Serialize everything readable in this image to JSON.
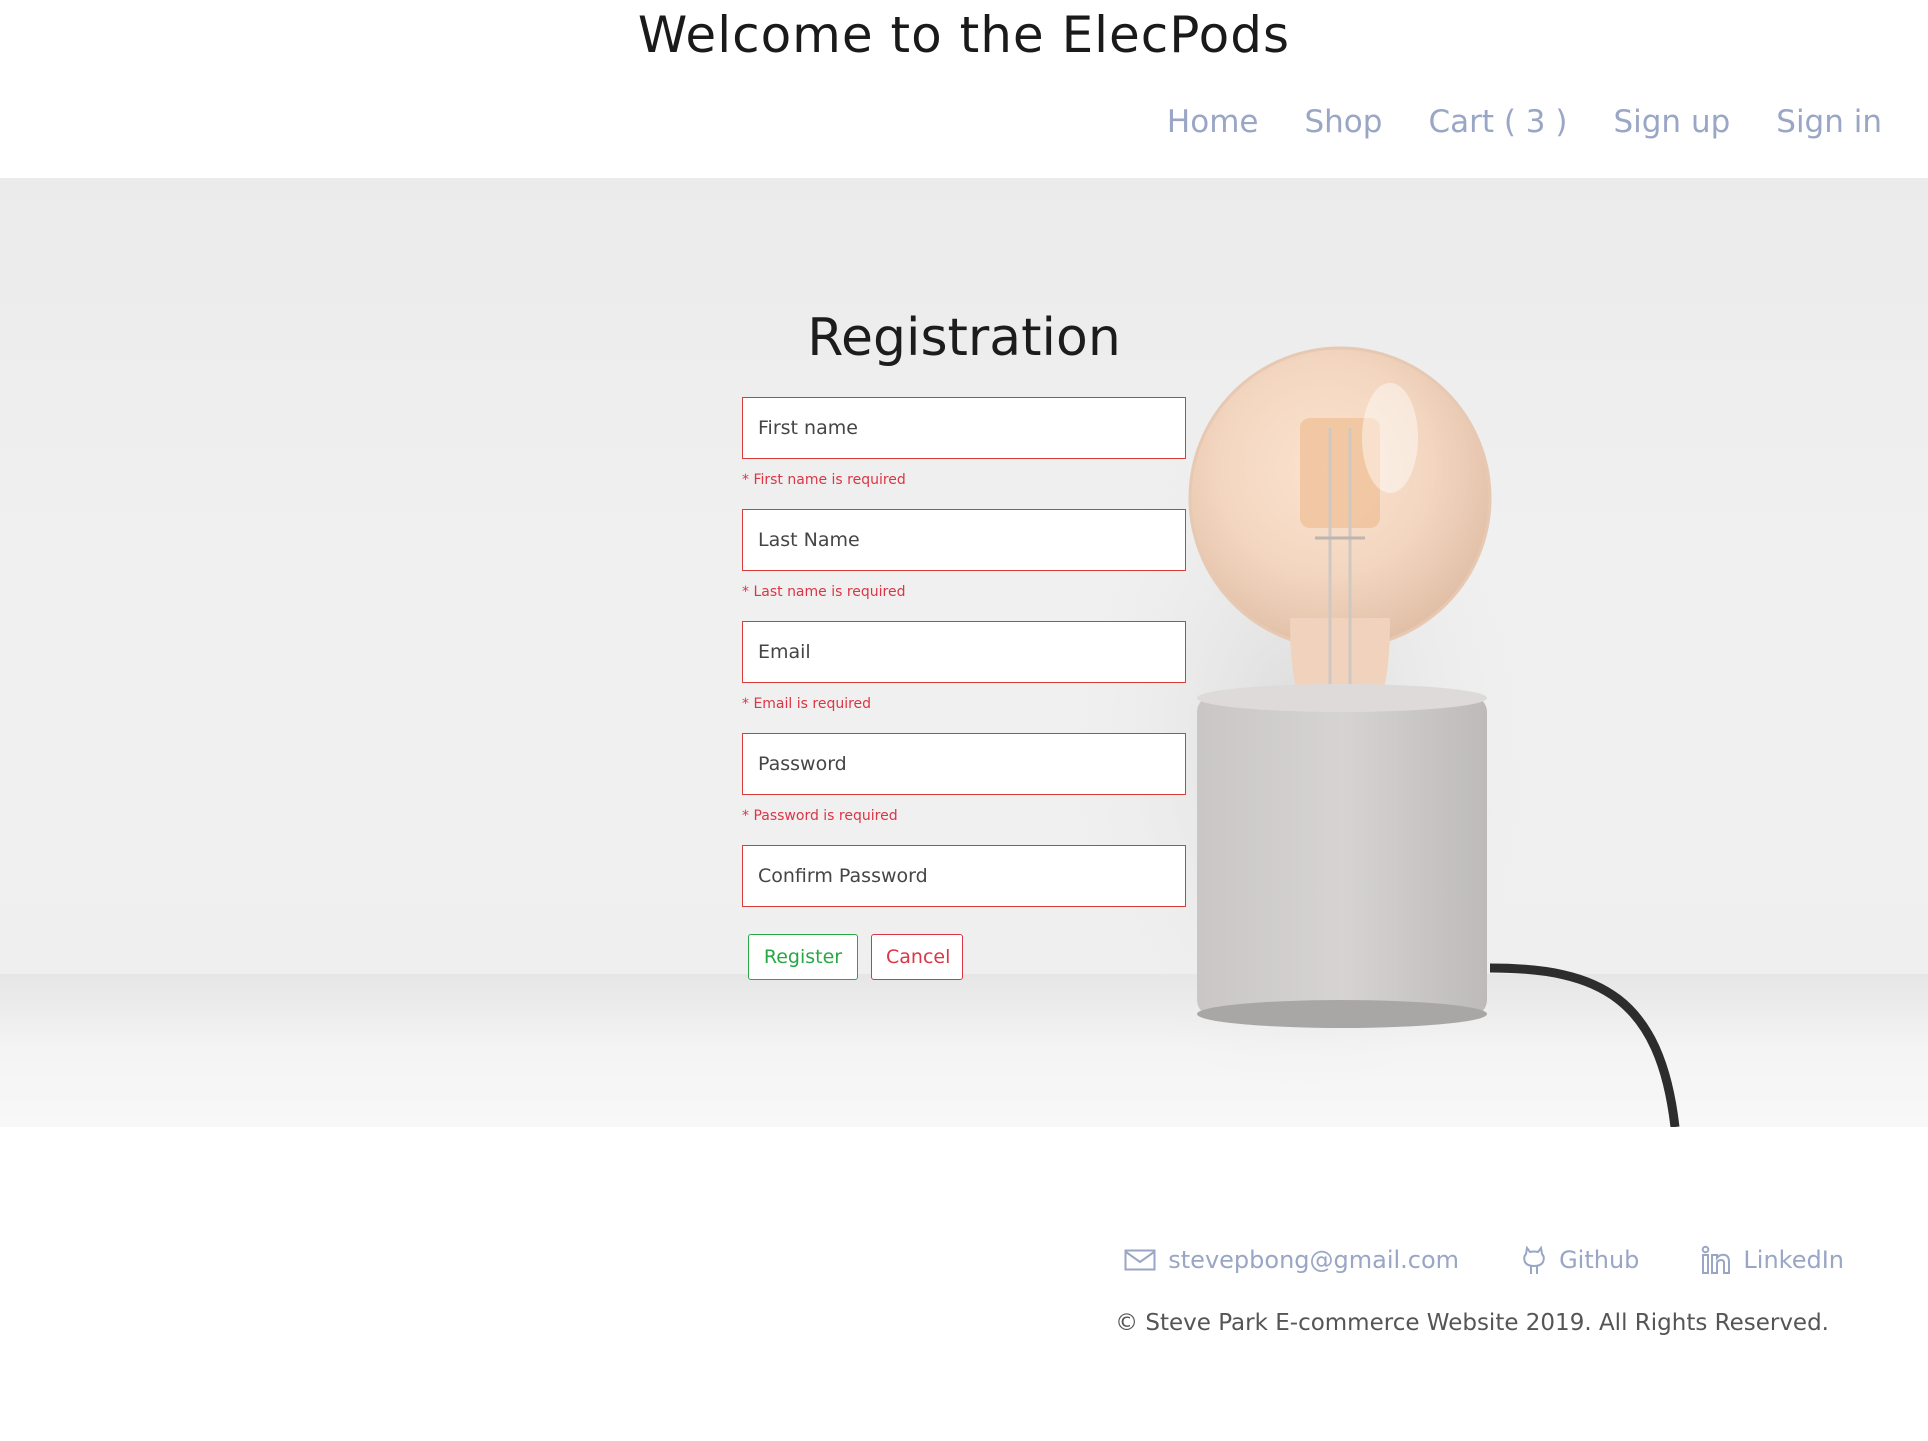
{
  "header": {
    "title": "Welcome to the ElecPods",
    "nav": {
      "home": "Home",
      "shop": "Shop",
      "cart": "Cart ( 3 )",
      "signup": "Sign up",
      "signin": "Sign in"
    }
  },
  "registration": {
    "title": "Registration",
    "fields": {
      "first_name": {
        "placeholder": "First name",
        "error": "* First name is required"
      },
      "last_name": {
        "placeholder": "Last Name",
        "error": "* Last name is required"
      },
      "email": {
        "placeholder": "Email",
        "error": "* Email is required"
      },
      "password": {
        "placeholder": "Password",
        "error": "* Password is required"
      },
      "confirm_password": {
        "placeholder": "Confirm Password"
      }
    },
    "buttons": {
      "register": "Register",
      "cancel": "Cancel"
    }
  },
  "footer": {
    "email": "stevepbong@gmail.com",
    "github": "Github",
    "linkedin": "LinkedIn",
    "copyright": "© Steve Park E-commerce Website 2019. All Rights Reserved."
  },
  "colors": {
    "nav_link": "#9aa6c6",
    "error_red": "#dc3545",
    "success_green": "#28a745"
  },
  "icons": [
    "mail-icon",
    "github-icon",
    "linkedin-icon"
  ]
}
